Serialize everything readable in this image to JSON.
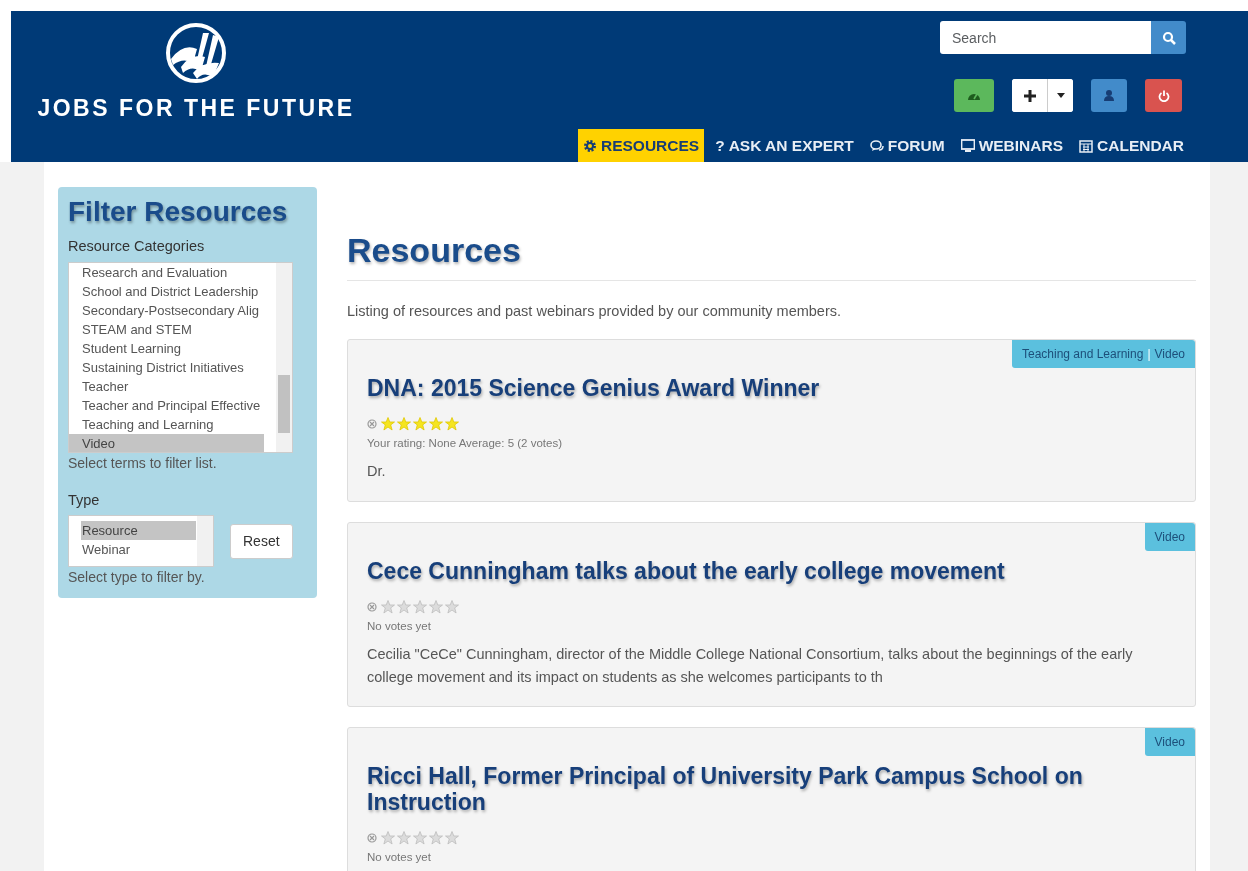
{
  "brand": {
    "name": "JOBS FOR THE FUTURE"
  },
  "search": {
    "placeholder": "Search"
  },
  "nav": [
    {
      "label": "RESOURCES",
      "selected": true
    },
    {
      "label": "ASK AN EXPERT",
      "glyph": "?",
      "selected": false
    },
    {
      "label": "FORUM",
      "selected": false
    },
    {
      "label": "WEBINARS",
      "selected": false
    },
    {
      "label": "CALENDAR",
      "selected": false
    }
  ],
  "sidebar": {
    "title": "Filter Resources",
    "categories_label": "Resource Categories",
    "categories": [
      {
        "label": "Research and Evaluation",
        "selected": false
      },
      {
        "label": "School and District Leadership",
        "selected": false
      },
      {
        "label": "Secondary-Postsecondary Alig",
        "selected": false
      },
      {
        "label": "STEAM and STEM",
        "selected": false
      },
      {
        "label": "Student Learning",
        "selected": false
      },
      {
        "label": "Sustaining District Initiatives",
        "selected": false
      },
      {
        "label": "Teacher",
        "selected": false
      },
      {
        "label": "Teacher and Principal Effective",
        "selected": false
      },
      {
        "label": "Teaching and Learning",
        "selected": false
      },
      {
        "label": "Video",
        "selected": true
      }
    ],
    "categories_help": "Select terms to filter list.",
    "type_label": "Type",
    "types": [
      {
        "label": "Resource",
        "selected": true
      },
      {
        "label": "Webinar",
        "selected": false
      }
    ],
    "reset": "Reset",
    "type_help": "Select type to filter by."
  },
  "main": {
    "title": "Resources",
    "description": "Listing of resources and past webinars provided by our community members.",
    "tag_separator": "|",
    "items": [
      {
        "tags": [
          "Teaching and Learning",
          "Video"
        ],
        "title": "DNA: 2015 Science Genius Award Winner",
        "stars": 5,
        "rating": "Your rating: None Average: 5 (2 votes)",
        "summary": "Dr."
      },
      {
        "tags": [
          "Video"
        ],
        "title": "Cece Cunningham talks about the early college movement",
        "stars": 0,
        "rating": "No votes yet",
        "summary": "Cecilia \"CeCe\" Cunningham, director of the Middle College National Consortium, talks about the beginnings of the early college movement and its impact on students as she welcomes participants to th"
      },
      {
        "tags": [
          "Video"
        ],
        "title": "Ricci Hall, Former Principal of University Park Campus School on Instruction",
        "stars": 0,
        "rating": "No votes yet"
      }
    ]
  }
}
